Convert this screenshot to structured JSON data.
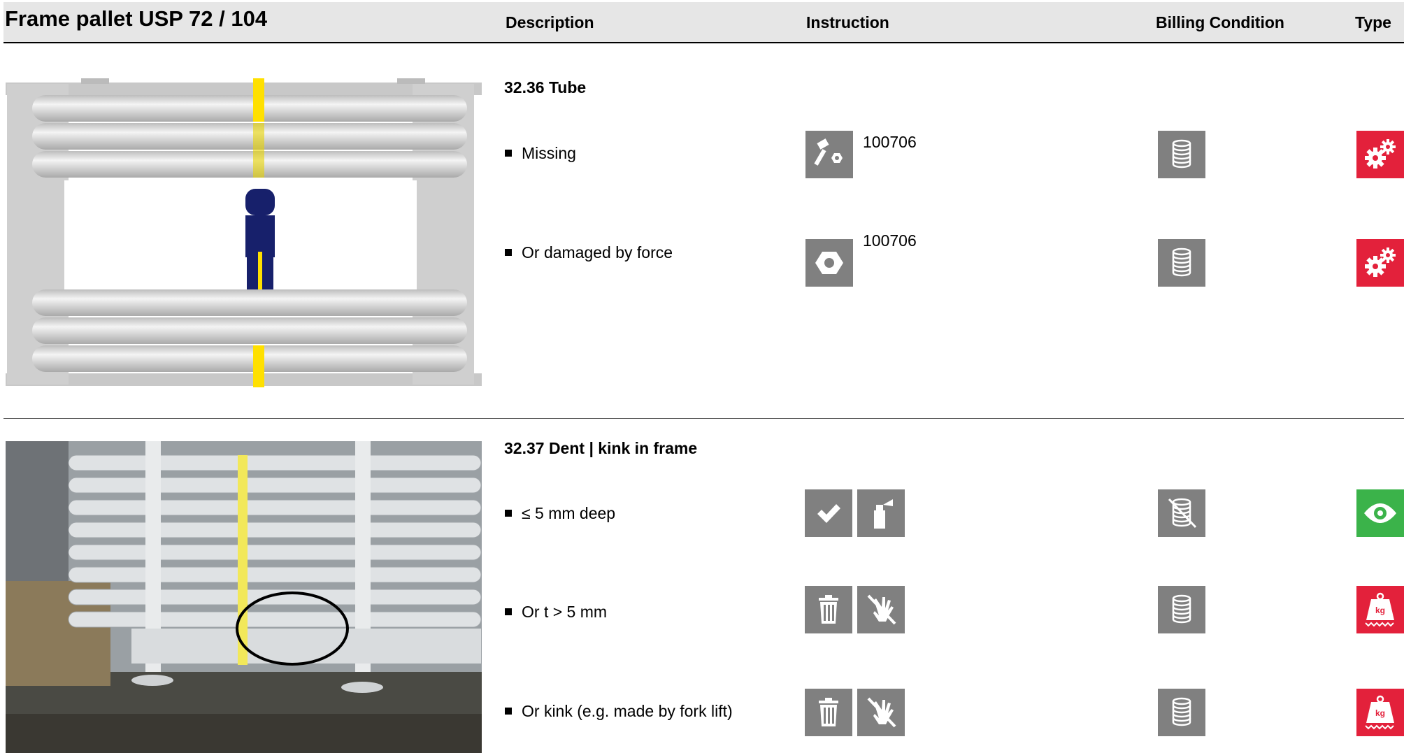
{
  "header": {
    "title": "Frame pallet USP 72 / 104",
    "col_description": "Description",
    "col_instruction": "Instruction",
    "col_billing": "Billing Condition",
    "col_type": "Type"
  },
  "sections": [
    {
      "title": "32.36 Tube",
      "items": [
        {
          "label": "Missing",
          "code": "100706",
          "instruction_icons": [
            "bolt-nut-icon"
          ],
          "billing_icon": "coin-stack-icon",
          "type_icon": "gears-icon",
          "type_color": "#e3213b"
        },
        {
          "label": "Or damaged by force",
          "code": "100706",
          "instruction_icons": [
            "nut-icon"
          ],
          "billing_icon": "coin-stack-icon",
          "type_icon": "gears-icon",
          "type_color": "#e3213b"
        }
      ]
    },
    {
      "title": "32.37 Dent | kink in frame",
      "items": [
        {
          "label": "≤ 5 mm deep",
          "instruction_icons": [
            "check-icon",
            "spray-can-icon"
          ],
          "billing_icon": "no-charge-icon",
          "type_icon": "eye-icon",
          "type_color": "#3bb34a"
        },
        {
          "label": "Or t > 5 mm",
          "instruction_icons": [
            "trash-icon",
            "no-repair-hand-icon"
          ],
          "billing_icon": "coin-stack-icon",
          "type_icon": "weight-kg-icon",
          "type_color": "#e3213b"
        },
        {
          "label": "Or kink (e.g. made by fork lift)",
          "instruction_icons": [
            "trash-icon",
            "no-repair-hand-icon"
          ],
          "billing_icon": "coin-stack-icon",
          "type_icon": "weight-kg-icon",
          "type_color": "#e3213b"
        }
      ]
    }
  ],
  "weight_label": "kg"
}
